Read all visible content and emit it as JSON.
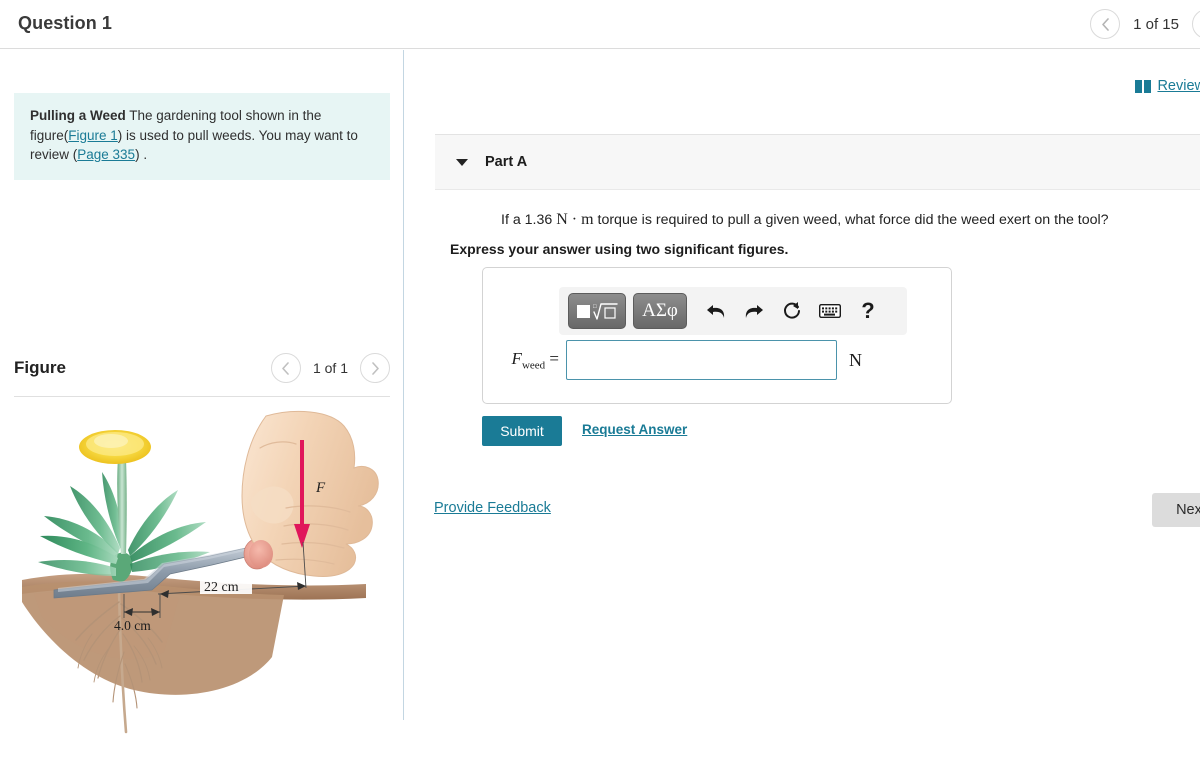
{
  "header": {
    "title": "Question 1",
    "counter": "1 of 15",
    "prev_icon": "chevron-left-icon",
    "next_icon": "chevron-right-icon"
  },
  "left": {
    "prompt": {
      "bold_lead": "Pulling a Weed",
      "text_1": " The gardening tool shown in the figure(",
      "link_figure": "Figure 1",
      "text_2": ") is used to pull weeds. You may want to review (",
      "link_page": "Page 335",
      "text_3": ") ."
    },
    "figure": {
      "title": "Figure",
      "counter": "1 of 1",
      "prev_icon": "chevron-left-icon",
      "next_icon": "chevron-right-icon",
      "labels": {
        "force": "F",
        "lever_arm": "22 cm",
        "root_depth": "4.0 cm"
      },
      "colors": {
        "force_arrow": "#e0165b",
        "tool_metal": "#9aa7b5",
        "soil": "#b08a6d",
        "leaf": "#3e9c6d",
        "flower": "#f5d33a",
        "skin": "#f2d6bd"
      }
    }
  },
  "right": {
    "review": {
      "icon": "book-icon",
      "label": "Review"
    },
    "part": {
      "caret_icon": "caret-down-icon",
      "label": "Part A"
    },
    "question": {
      "text_1": "If a 1.36 ",
      "unit_n": "N",
      "dot": " · ",
      "unit_m": "m",
      "text_2": " torque is required to pull a given weed, what force did the weed exert on the tool?"
    },
    "instruction": "Express your answer using two significant figures.",
    "toolbar": {
      "template_icon": "square-root-template-icon",
      "greek_label": "ΑΣφ",
      "undo_icon": "undo-icon",
      "redo_icon": "redo-icon",
      "reset_icon": "reset-icon",
      "keyboard_icon": "keyboard-icon",
      "help_label": "?"
    },
    "answer": {
      "variable": "F",
      "subscript": "weed",
      "equals": " =",
      "value": "",
      "placeholder": "",
      "unit": "N"
    },
    "submit_label": "Submit",
    "request_answer_label": "Request Answer",
    "provide_feedback_label": "Provide Feedback",
    "next_label": "Next"
  },
  "colors": {
    "accent_teal": "#1a7b96",
    "prompt_bg": "#e7f5f4",
    "part_bar_bg": "#f7f7f7",
    "input_border": "#4b93ab",
    "next_bg": "#dcdcdc"
  }
}
